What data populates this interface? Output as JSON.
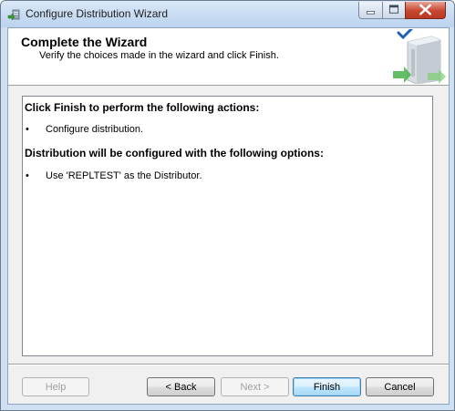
{
  "window": {
    "title": "Configure Distribution Wizard"
  },
  "header": {
    "title": "Complete the Wizard",
    "subtitle": "Verify the choices made in the wizard and click Finish."
  },
  "content": {
    "actions_heading": "Click Finish to perform the following actions:",
    "actions": [
      "Configure distribution."
    ],
    "options_heading": "Distribution will be configured with the following options:",
    "options": [
      "Use 'REPLTEST' as the Distributor."
    ],
    "bullet": "•"
  },
  "buttons": {
    "help": "Help",
    "back": "< Back",
    "next": "Next >",
    "finish": "Finish",
    "cancel": "Cancel"
  },
  "colors": {
    "titlebar": "#c9dcf2",
    "close_button": "#c7462f",
    "default_button_border": "#3c7fb1",
    "check_mark": "#1f5fb4"
  },
  "icons": {
    "app": "wizard-app-icon",
    "header_art": "server-checkmark-icon"
  }
}
